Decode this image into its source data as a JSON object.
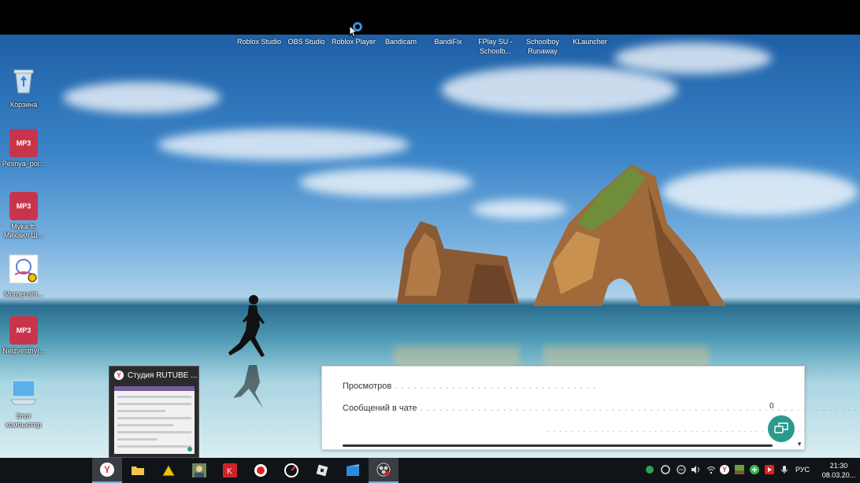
{
  "desktop": {
    "left_icons": [
      {
        "label": "Корзина",
        "kind": "recycle-bin"
      },
      {
        "label": "Pesnya_pol...",
        "kind": "mp3",
        "badge": "MP3"
      },
      {
        "label": "Myka ft. Михаил Ш...",
        "kind": "mp3",
        "badge": "MP3"
      },
      {
        "label": "Morgensht...",
        "kind": "image"
      },
      {
        "label": "Neizvestnyj...",
        "kind": "mp3",
        "badge": "MP3"
      },
      {
        "label": "Этот компьютер",
        "kind": "this-pc"
      }
    ],
    "top_icons": [
      {
        "label": "Roblox Studio"
      },
      {
        "label": "OBS Studio"
      },
      {
        "label": "Roblox Player"
      },
      {
        "label": "Bandicam"
      },
      {
        "label": "BandiFix"
      },
      {
        "label": "FPlay SU - Schoolb..."
      },
      {
        "label": "Schoolboy Runaway"
      },
      {
        "label": "KLauncher"
      }
    ]
  },
  "preview": {
    "title": "Студия RUTUBE ..."
  },
  "stats_panel": {
    "rows": [
      {
        "label": "Просмотров",
        "value": ""
      },
      {
        "label": "Сообщений в чате",
        "value": "0"
      }
    ]
  },
  "taskbar": {
    "apps": [
      {
        "name": "yandex-browser-icon",
        "active": true
      },
      {
        "name": "file-explorer-icon"
      },
      {
        "name": "app-triangle-icon"
      },
      {
        "name": "avatar-app-icon"
      },
      {
        "name": "kaspersky-icon"
      },
      {
        "name": "record-icon"
      },
      {
        "name": "bandicam-icon"
      },
      {
        "name": "roblox-icon"
      },
      {
        "name": "windows-store-icon"
      },
      {
        "name": "obs-icon",
        "active": true
      }
    ],
    "language": "РУС",
    "time": "21:30",
    "date": "08.03.20..."
  },
  "colors": {
    "accent": "#2a9a8c",
    "mp3_badge": "#c8354b",
    "taskbar": "#101418"
  }
}
